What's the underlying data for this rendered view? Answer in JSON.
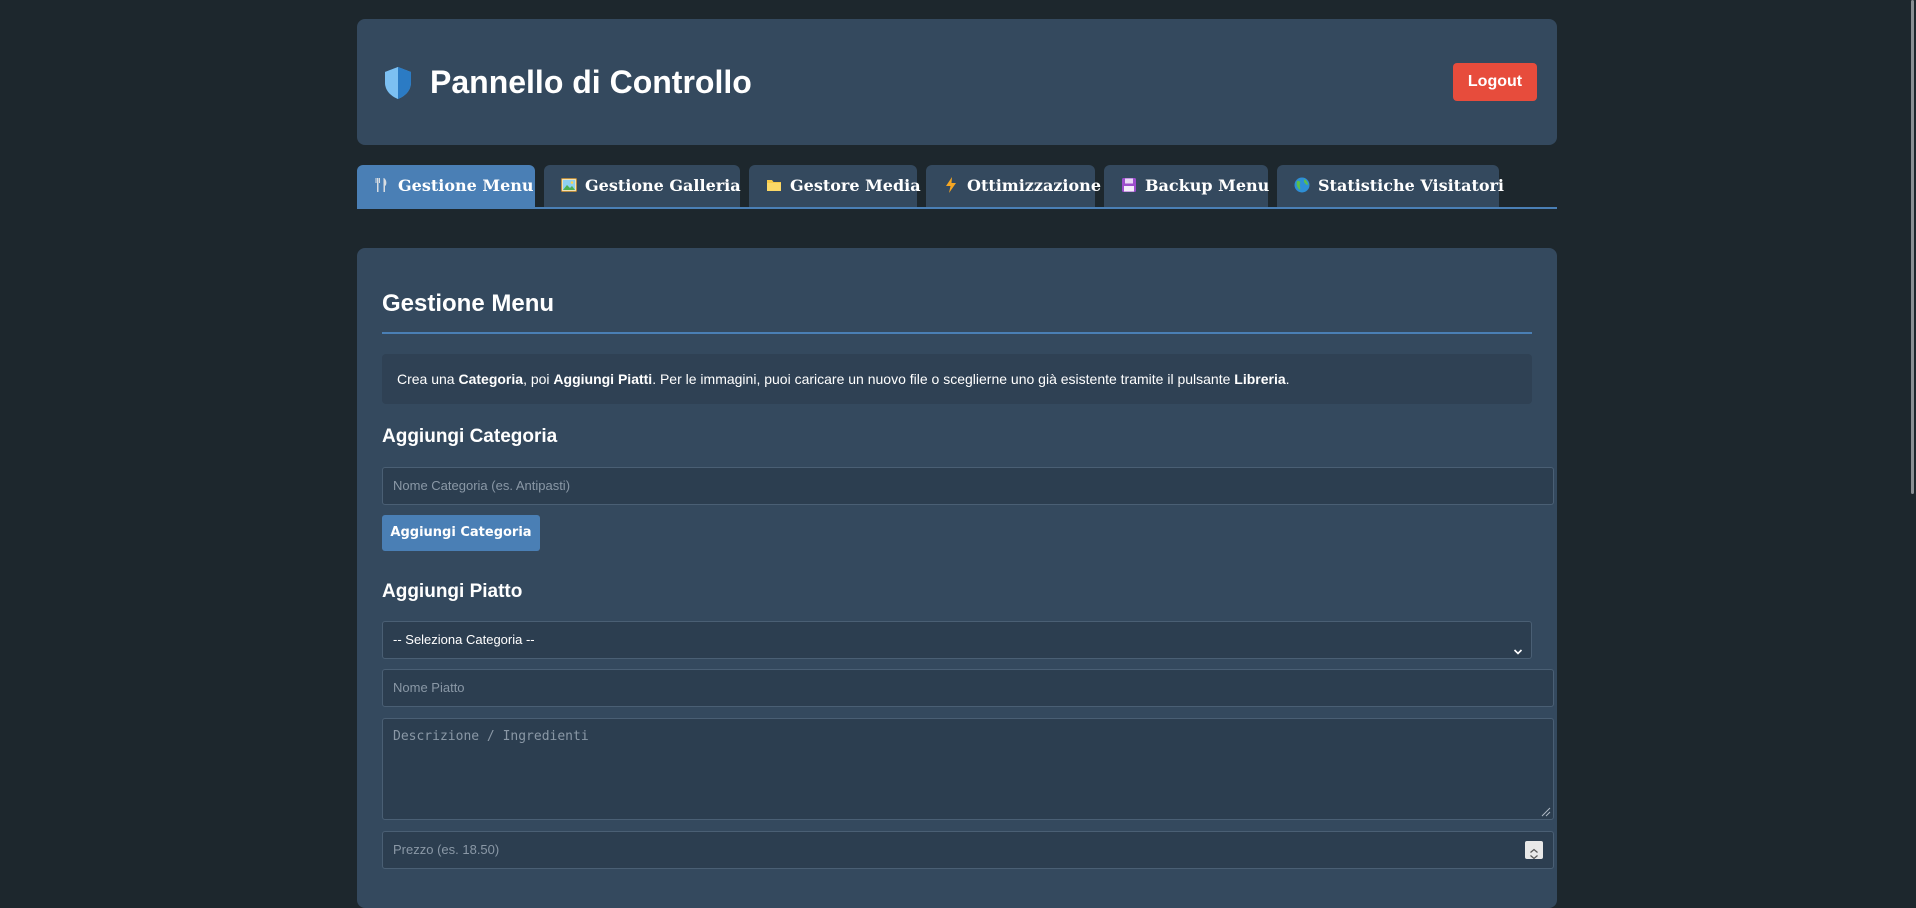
{
  "header": {
    "title": "Pannello di Controllo",
    "logout_label": "Logout",
    "icon": "shield-icon"
  },
  "tabs": [
    {
      "label": "Gestione Menu",
      "icon": "fork-knife-icon",
      "active": true
    },
    {
      "label": "Gestione Galleria",
      "icon": "picture-icon",
      "active": false
    },
    {
      "label": "Gestore Media",
      "icon": "folder-icon",
      "active": false
    },
    {
      "label": "Ottimizzazione",
      "icon": "lightning-icon",
      "active": false
    },
    {
      "label": "Backup Menu",
      "icon": "floppy-disk-icon",
      "active": false
    },
    {
      "label": "Statistiche Visitatori",
      "icon": "globe-icon",
      "active": false
    }
  ],
  "main": {
    "title": "Gestione Menu",
    "info": {
      "t1": "Crea una ",
      "b1": "Categoria",
      "t2": ", poi ",
      "b2": "Aggiungi Piatti",
      "t3": ". Per le immagini, puoi caricare un nuovo file o sceglierne uno già esistente tramite il pulsante ",
      "b3": "Libreria",
      "t4": "."
    },
    "add_category": {
      "title": "Aggiungi Categoria",
      "name_placeholder": "Nome Categoria (es. Antipasti)",
      "button_label": "Aggiungi Categoria"
    },
    "add_dish": {
      "title": "Aggiungi Piatto",
      "category_select": "-- Seleziona Categoria --",
      "name_placeholder": "Nome Piatto",
      "description_placeholder": "Descrizione / Ingredienti",
      "price_placeholder": "Prezzo (es. 18.50)"
    }
  },
  "colors": {
    "page_bg": "#1d272d",
    "panel_bg": "#34495e",
    "accent": "#4a7fb5",
    "danger": "#e74c3c",
    "input_bg": "#2c3e50"
  }
}
